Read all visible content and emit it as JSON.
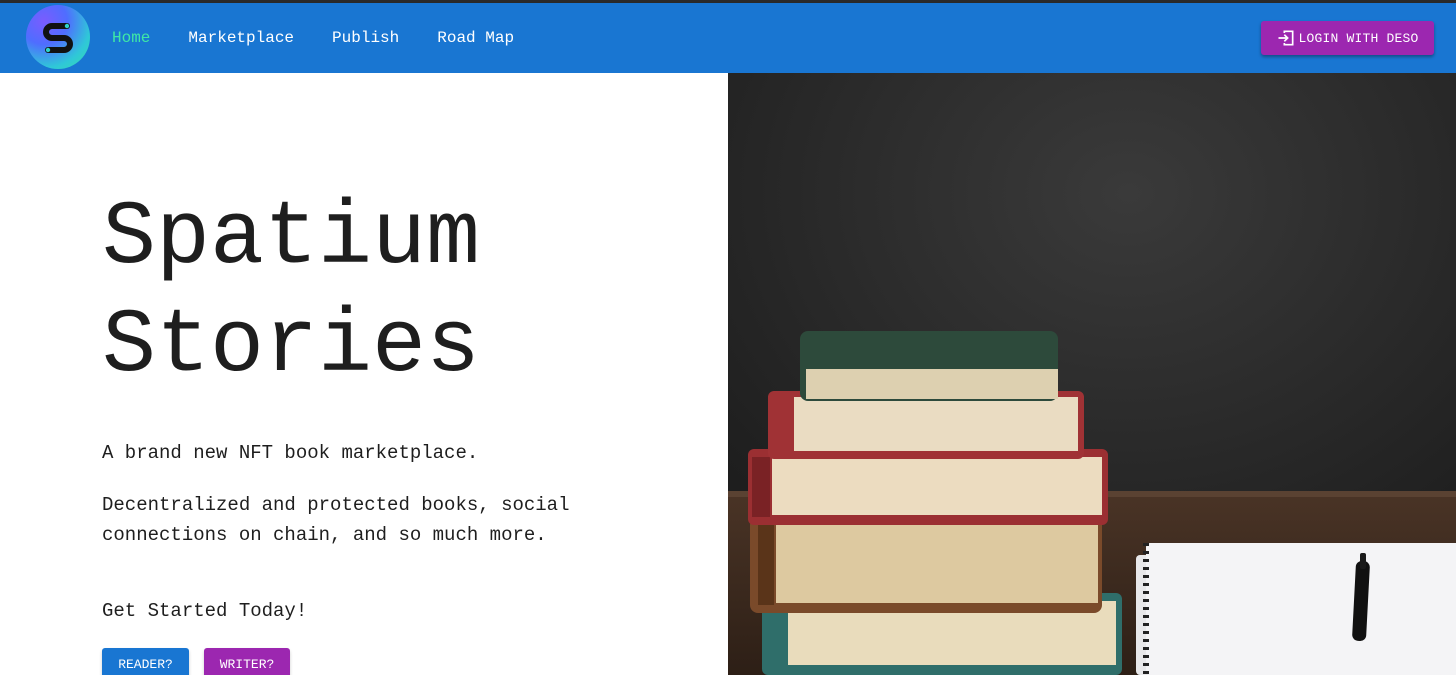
{
  "nav": {
    "logo_letter": "S",
    "links": [
      "Home",
      "Marketplace",
      "Publish",
      "Road Map"
    ],
    "active_link": "Home",
    "login_label": "LOGIN WITH DESO",
    "login_icon": "login-icon"
  },
  "hero": {
    "title": "Spatium Stories",
    "tagline": "A brand new NFT book marketplace.",
    "description": "Decentralized and protected books, social connections on chain, and so much more.",
    "cta": "Get Started Today!",
    "reader_button": "READER?",
    "writer_button": "WRITER?"
  },
  "image": {
    "subject": "stack-of-old-books-and-notebook-with-pen"
  },
  "colors": {
    "navbar": "#1976d2",
    "active_link": "#3ee8a6",
    "login_button": "#9c27b0",
    "reader_button": "#1976d2",
    "writer_button": "#9c27b0"
  }
}
